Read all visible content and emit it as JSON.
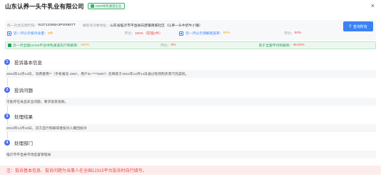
{
  "header": {
    "company_name": "山东认养一头牛乳业有限公司",
    "badge_label": "ODR绿色通道企业",
    "close_label": "×"
  },
  "info": {
    "credit_code_label": "统一社会信用代码：",
    "credit_code_value": "91371326MA3PGR807T",
    "address_label": "被投诉对象地址：",
    "address_value": "山东省临沂市平邑县白彦镇南坡社区（认养一头牛奶牛小镇）",
    "query_button_label": "查询所有"
  },
  "stats": [
    {
      "label": "近一月公示投诉总量：",
      "value": "5件",
      "ratio_label": "环比：",
      "ratio_value": "150%（前值2件）"
    },
    {
      "label": "近一月公示调解结案率：",
      "value": "60%",
      "ratio_label": "环比：",
      "ratio_value": "60%"
    }
  ],
  "green_channel": {
    "label": "近一月全国12315平台绿色通道先行和解率：",
    "value": "100%",
    "ratio_label": "环比：",
    "ratio_value": "0%",
    "compare_label": "高于全国平均和解率：",
    "compare_value": "46.84%"
  },
  "sections": [
    {
      "num": "1",
      "title": "投诉基本信息",
      "body": "2024年12月14日，消费者用**（手机尾号 4367，用户ID ****9307）反映其于2024年12月14日通过现场购买蒸汽热菜机。"
    },
    {
      "num": "2",
      "title": "投诉问题",
      "body": "可能存在食品安全问题，要求退货退款。"
    },
    {
      "num": "3",
      "title": "处理结果",
      "body": "2024年12月18日，双方自行和解或者投诉人撤回投诉"
    },
    {
      "num": "4",
      "title": "处理部门",
      "body": "临沂市平邑县市场监督管理局"
    }
  ],
  "footer_note": "注：投诉基本信息、投诉问题为当事人在全国12315平台投诉时自行填写。",
  "colors": {
    "accent": "#3b82f6",
    "badge": "#4a6cf7",
    "green": "#22a05a",
    "warning": "#ef4444"
  }
}
